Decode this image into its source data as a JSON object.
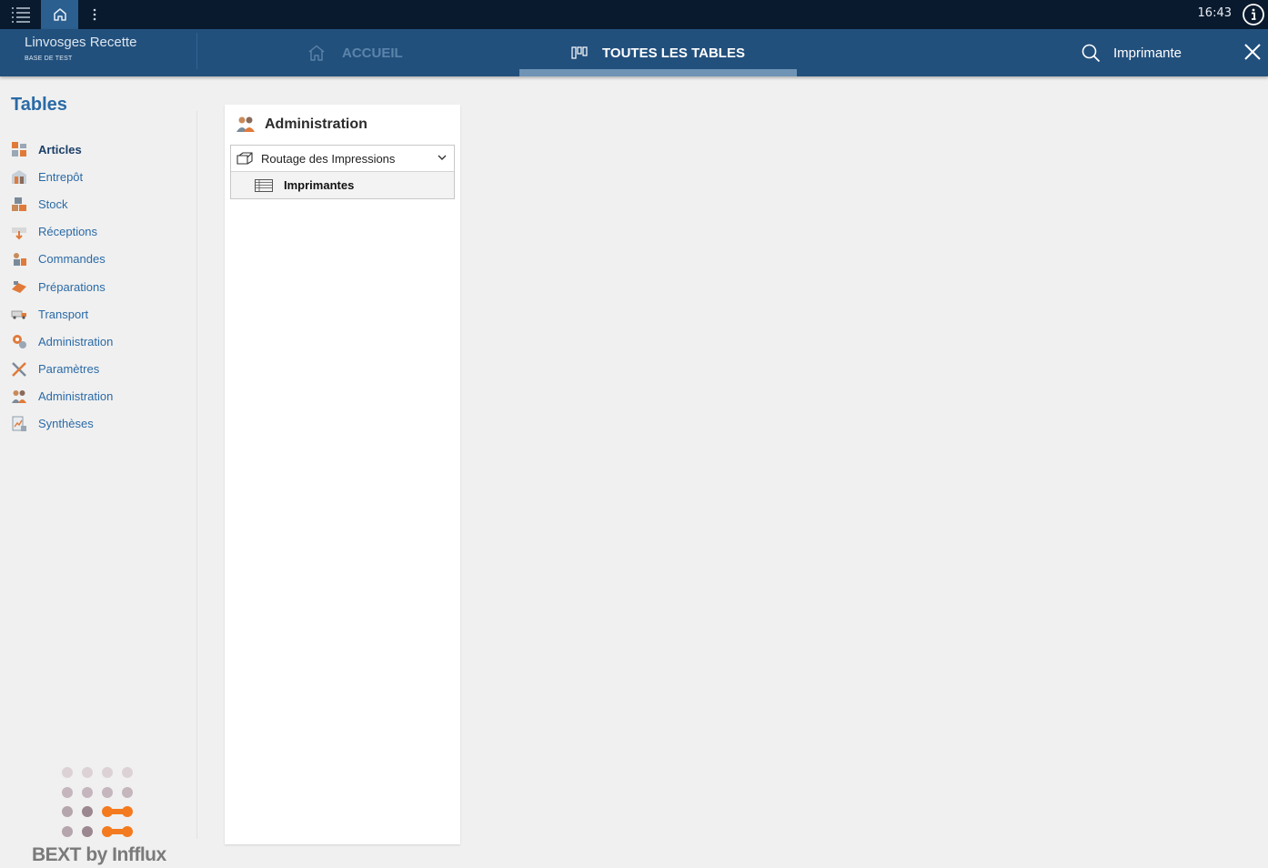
{
  "system_bar": {
    "time": "16:43"
  },
  "header": {
    "app_title": "Linvosges Recette",
    "app_subtitle": "BASE DE TEST",
    "tabs": [
      {
        "label": "ACCUEIL",
        "active": false
      },
      {
        "label": "TOUTES LES TABLES",
        "active": true
      }
    ],
    "search_label": "Imprimante"
  },
  "sidebar": {
    "title": "Tables",
    "items": [
      {
        "label": "Articles",
        "icon": "articles-icon",
        "active": true
      },
      {
        "label": "Entrepôt",
        "icon": "warehouse-icon"
      },
      {
        "label": "Stock",
        "icon": "stock-icon"
      },
      {
        "label": "Réceptions",
        "icon": "receptions-icon"
      },
      {
        "label": "Commandes",
        "icon": "orders-icon"
      },
      {
        "label": "Préparations",
        "icon": "preparations-icon"
      },
      {
        "label": "Transport",
        "icon": "truck-icon"
      },
      {
        "label": "Administration",
        "icon": "admin-gear-icon"
      },
      {
        "label": "Paramètres",
        "icon": "tools-icon"
      },
      {
        "label": "Administration",
        "icon": "users-icon"
      },
      {
        "label": "Synthèses",
        "icon": "report-icon"
      }
    ]
  },
  "logo": {
    "text": "BEXT by Infflux"
  },
  "panel": {
    "title": "Administration",
    "group": {
      "label": "Routage des Impressions",
      "items": [
        {
          "label": "Imprimantes"
        }
      ]
    }
  },
  "colors": {
    "header": "#22507d",
    "system_bar": "#0a1a2e",
    "link": "#2a6aa6",
    "accent": "#f47a1f"
  }
}
